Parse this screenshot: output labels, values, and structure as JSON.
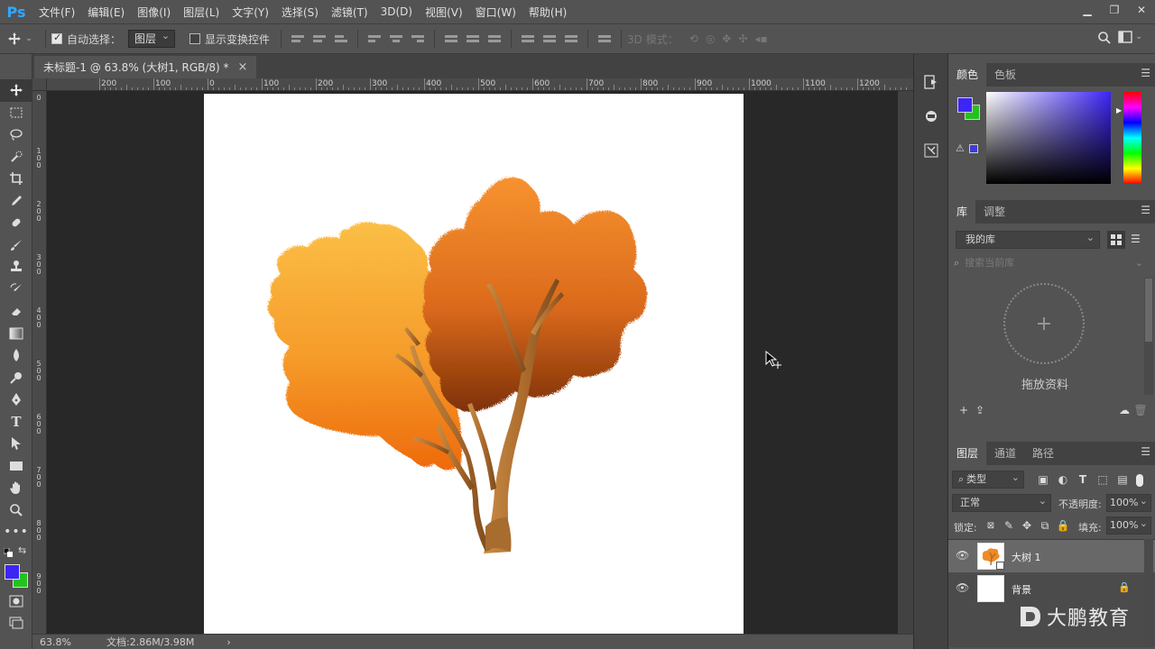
{
  "app": {
    "logo": "Ps",
    "menu": [
      "文件(F)",
      "编辑(E)",
      "图像(I)",
      "图层(L)",
      "文字(Y)",
      "选择(S)",
      "滤镜(T)",
      "3D(D)",
      "视图(V)",
      "窗口(W)",
      "帮助(H)"
    ],
    "window_controls": [
      "minimize-icon",
      "restore-icon",
      "close-icon"
    ]
  },
  "options_bar": {
    "auto_select_label": "自动选择：",
    "auto_select_checked": true,
    "auto_select_target": "图层",
    "show_transform_label": "显示变换控件",
    "show_transform_checked": false,
    "mode_3d_label": "3D 模式："
  },
  "document": {
    "tab_title": "未标题-1 @ 63.8% (大树1, RGB/8) *",
    "close_glyph": "×",
    "ruler_h_labels": [
      "200",
      "100",
      "0",
      "100",
      "200",
      "300",
      "400",
      "500",
      "600",
      "700",
      "800",
      "900",
      "1000",
      "1100",
      "1200"
    ],
    "ruler_v_labels": [
      "0",
      "100",
      "200",
      "300",
      "400",
      "500",
      "600",
      "700",
      "800",
      "900"
    ]
  },
  "status": {
    "zoom": "63.8%",
    "doc_size": "文档:2.86M/3.98M",
    "arrow": "›"
  },
  "color_panel": {
    "tabs": [
      "颜色",
      "色板"
    ],
    "foreground": "#3d25f5",
    "background": "#24c21f"
  },
  "library_panel": {
    "tabs": [
      "库",
      "调整"
    ],
    "library_name": "我的库",
    "search_placeholder": "搜索当前库",
    "drop_label": "拖放资料",
    "plus_glyph": "+"
  },
  "layers_panel": {
    "tabs": [
      "图层",
      "通道",
      "路径"
    ],
    "filter_label": "类型",
    "blend_mode": "正常",
    "opacity_label": "不透明度:",
    "opacity_value": "100%",
    "lock_label": "锁定:",
    "fill_label": "填充:",
    "fill_value": "100%",
    "layers": [
      {
        "name": "大树 1",
        "selected": true
      },
      {
        "name": "背景",
        "selected": false,
        "locked": true
      }
    ]
  },
  "watermark": {
    "text": "大鹏教育"
  }
}
